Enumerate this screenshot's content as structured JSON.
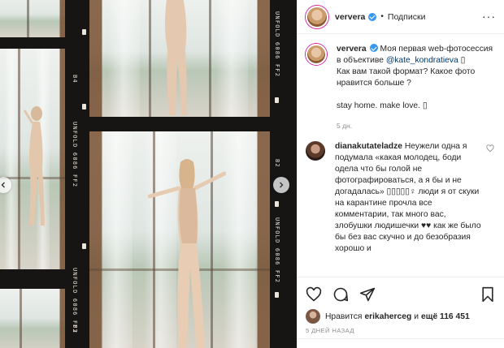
{
  "post": {
    "username": "ververa",
    "follow_label": "Подписки",
    "caption_line1": "Моя первая web-фотосессия в объективе",
    "mention": "@kate_kondratieva",
    "caption_line2": "Как вам такой формат? Какое фото нравится больше ?",
    "caption_line3": "stay home. make love. ▯",
    "caption_age": "5 дн."
  },
  "comment": {
    "username": "dianakutateladze",
    "text": "Неужели одна я подумала «какая молодец, боди одела что бы голой не фотографироваться, а я бы и не догадалась» ▯▯▯▯▯♀ люди я от скуки на карантине прочла все комментарии, так много вас, злобушки людишечки ♥♥ как же было бы без вас скучно и до безобразия хорошо и"
  },
  "likes": {
    "prefix": "Нравится",
    "user": "erikaherceg",
    "middle": "и",
    "count": "ещё 116 451"
  },
  "date_label": "5 ДНЕЙ НАЗАД",
  "film": {
    "edge_label_a": "UNFOLD 6086 FF2",
    "edge_label_b": "B2",
    "edge_label_c": "B3",
    "edge_label_d": "B4"
  },
  "icons": {
    "more": "more-horizontal-icon",
    "heart": "heart-icon",
    "comment": "comment-icon",
    "share": "share-icon",
    "save": "bookmark-icon",
    "prev": "chevron-left-icon",
    "next": "chevron-right-icon"
  },
  "colors": {
    "verified": "#3897f0",
    "mention": "#00376b",
    "muted": "#8e8e8e",
    "film": "#171514"
  }
}
